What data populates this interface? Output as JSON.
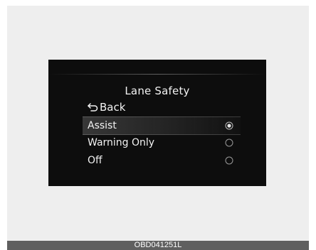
{
  "screen": {
    "title": "Lane Safety",
    "back_label": "Back",
    "options": [
      {
        "label": "Assist",
        "selected": true
      },
      {
        "label": "Warning Only",
        "selected": false
      },
      {
        "label": "Off",
        "selected": false
      }
    ]
  },
  "footer": {
    "code": "OBD041251L"
  },
  "colors": {
    "screen_bg": "#0d0d0d",
    "text": "#f2f2f2",
    "frame_bg": "#eeeeee",
    "footer_bg": "#5f5f5f"
  }
}
